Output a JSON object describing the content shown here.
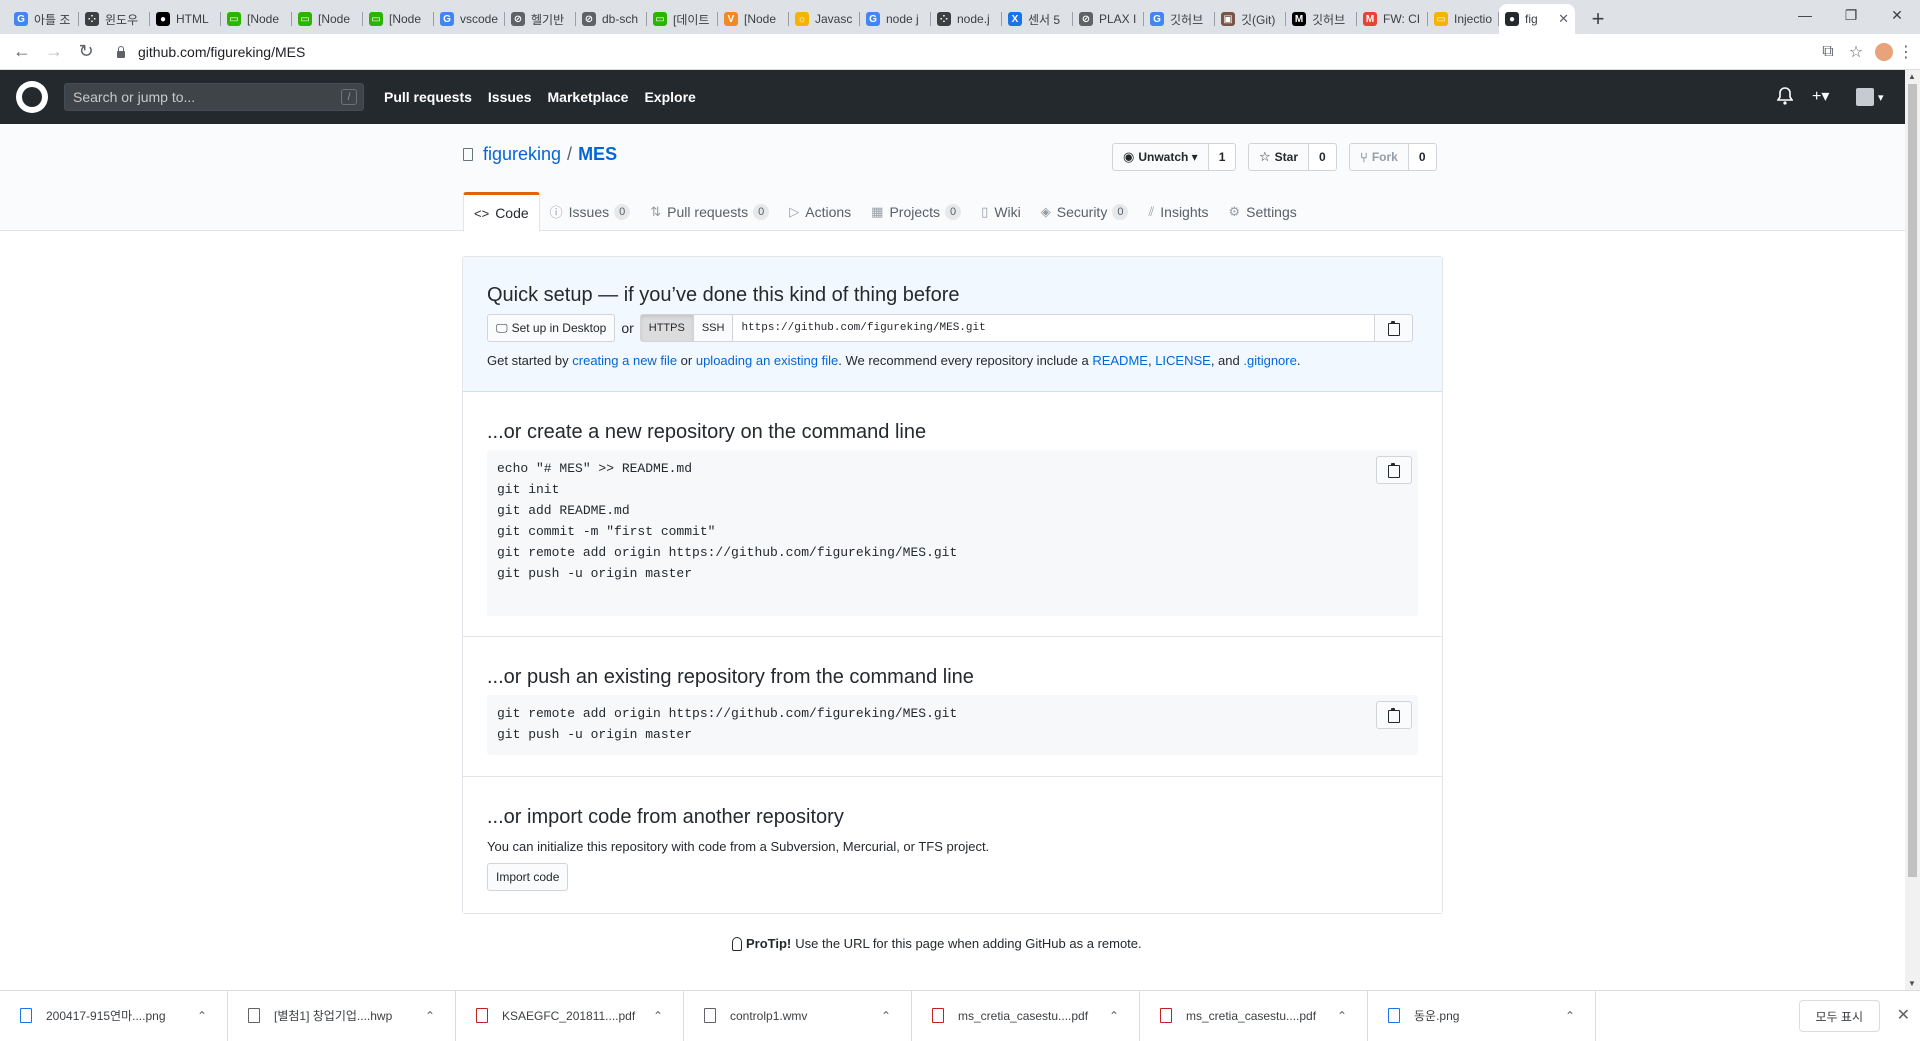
{
  "browser": {
    "tabs": [
      {
        "label": "아틀 조",
        "color": "#4285f4",
        "glyph": "G"
      },
      {
        "label": "윈도우",
        "color": "#3c4043",
        "glyph": "⁘"
      },
      {
        "label": "HTML",
        "color": "#000000",
        "glyph": "●"
      },
      {
        "label": "[Node",
        "color": "#2db400",
        "glyph": "▭"
      },
      {
        "label": "[Node",
        "color": "#2db400",
        "glyph": "▭"
      },
      {
        "label": "[Node",
        "color": "#2db400",
        "glyph": "▭"
      },
      {
        "label": "vscode",
        "color": "#4285f4",
        "glyph": "G"
      },
      {
        "label": "헬기반",
        "color": "#5f6368",
        "glyph": "⊘"
      },
      {
        "label": "db-sch",
        "color": "#5f6368",
        "glyph": "⊘"
      },
      {
        "label": "[데이트",
        "color": "#2db400",
        "glyph": "▭"
      },
      {
        "label": "[Node",
        "color": "#f08a24",
        "glyph": "V"
      },
      {
        "label": "Javasc",
        "color": "#f4b400",
        "glyph": "☼"
      },
      {
        "label": "node j",
        "color": "#4285f4",
        "glyph": "G"
      },
      {
        "label": "node.j",
        "color": "#3c4043",
        "glyph": "⁘"
      },
      {
        "label": "센서 5",
        "color": "#1a73e8",
        "glyph": "X"
      },
      {
        "label": "PLAX I",
        "color": "#5f6368",
        "glyph": "⊘"
      },
      {
        "label": "깃허브",
        "color": "#4285f4",
        "glyph": "G"
      },
      {
        "label": "깃(Git)",
        "color": "#795548",
        "glyph": "▣"
      },
      {
        "label": "깃허브",
        "color": "#000000",
        "glyph": "M"
      },
      {
        "label": "FW: CI",
        "color": "#ea4335",
        "glyph": "M"
      },
      {
        "label": "Injectio",
        "color": "#f4b400",
        "glyph": "▭"
      },
      {
        "label": "fig",
        "color": "#24292e",
        "glyph": "●",
        "active": true
      }
    ],
    "new_tab_label": "+",
    "window_controls": {
      "minimize": "—",
      "restore": "❐",
      "close": "✕"
    },
    "url": "github.com/figureking/MES"
  },
  "github_header": {
    "search_placeholder": "Search or jump to...",
    "search_shortcut": "/",
    "nav": [
      "Pull requests",
      "Issues",
      "Marketplace",
      "Explore"
    ],
    "bell": "🔔",
    "plus": "+▾",
    "avatar": "▾"
  },
  "repo": {
    "owner": "figureking",
    "separator": "/",
    "name": "MES",
    "watch": {
      "label": "Unwatch ▾",
      "count": "1"
    },
    "star": {
      "label": "Star",
      "count": "0"
    },
    "fork": {
      "label": "Fork",
      "count": "0"
    },
    "tabs": [
      {
        "icon": "<>",
        "label": "Code",
        "selected": true
      },
      {
        "icon": "ⓘ",
        "label": "Issues",
        "count": "0"
      },
      {
        "icon": "⇅",
        "label": "Pull requests",
        "count": "0"
      },
      {
        "icon": "▷",
        "label": "Actions"
      },
      {
        "icon": "▦",
        "label": "Projects",
        "count": "0"
      },
      {
        "icon": "▯",
        "label": "Wiki"
      },
      {
        "icon": "◈",
        "label": "Security",
        "count": "0"
      },
      {
        "icon": "⫽",
        "label": "Insights"
      },
      {
        "icon": "⚙",
        "label": "Settings"
      }
    ]
  },
  "quick_setup": {
    "title": "Quick setup — if you’ve done this kind of thing before",
    "desktop_btn": "Set up in Desktop",
    "or": "or",
    "https": "HTTPS",
    "ssh": "SSH",
    "clone_url": "https://github.com/figureking/MES.git",
    "note_pre": "Get started by ",
    "note_link1": "creating a new file",
    "note_mid1": " or ",
    "note_link2": "uploading an existing file",
    "note_mid2": ". We recommend every repository include a ",
    "note_link3": "README",
    "note_mid3": ", ",
    "note_link4": "LICENSE",
    "note_mid4": ", and ",
    "note_link5": ".gitignore",
    "note_end": "."
  },
  "new_repo": {
    "title": "...or create a new repository on the command line",
    "code": "echo \"# MES\" >> README.md\ngit init\ngit add README.md\ngit commit -m \"first commit\"\ngit remote add origin https://github.com/figureking/MES.git\ngit push -u origin master"
  },
  "push_repo": {
    "title": "...or push an existing repository from the command line",
    "code": "git remote add origin https://github.com/figureking/MES.git\ngit push -u origin master"
  },
  "import_repo": {
    "title": "...or import code from another repository",
    "note": "You can initialize this repository with code from a Subversion, Mercurial, or TFS project.",
    "button": "Import code"
  },
  "protip": {
    "label": "ProTip!",
    "text": "Use the URL for this page when adding GitHub as a remote."
  },
  "downloads": {
    "items": [
      {
        "name": "200417-915연마....png",
        "type": "img"
      },
      {
        "name": "[별첨1] 창업기업....hwp",
        "type": "doc"
      },
      {
        "name": "KSAEGFC_201811....pdf",
        "type": "pdf"
      },
      {
        "name": "controlp1.wmv",
        "type": "doc"
      },
      {
        "name": "ms_cretia_casestu....pdf",
        "type": "pdf"
      },
      {
        "name": "ms_cretia_casestu....pdf",
        "type": "pdf"
      },
      {
        "name": "동운.png",
        "type": "img"
      }
    ],
    "show_all": "모두 표시",
    "close": "✕"
  }
}
